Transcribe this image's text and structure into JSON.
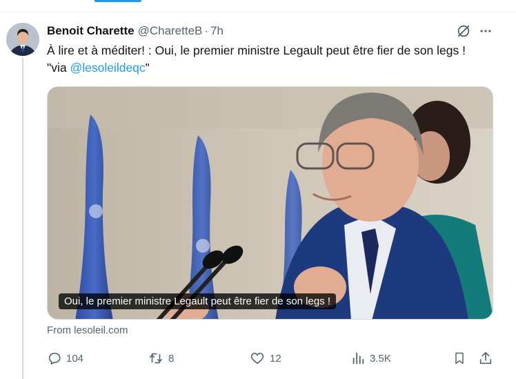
{
  "tweet": {
    "author_name": "Benoit Charette",
    "handle": "@CharetteB",
    "separator": "·",
    "time": "7h",
    "text_main": "À lire et à méditer! : Oui, le premier ministre Legault peut être fier de son legs ! \"via ",
    "mention": "@lesoleildeqc",
    "text_end": "\""
  },
  "card": {
    "caption": "Oui, le premier ministre Legault peut être fier de son legs !",
    "source": "From lesoleil.com"
  },
  "actions": {
    "replies": "104",
    "reposts": "8",
    "likes": "12",
    "views": "3.5K"
  },
  "colors": {
    "accent": "#1d9bf0",
    "text": "#0f1419",
    "muted": "#536471",
    "border": "#cfd9de"
  },
  "icons": [
    "grok-icon",
    "more-icon",
    "reply-icon",
    "repost-icon",
    "like-icon",
    "views-icon",
    "bookmark-icon",
    "share-icon"
  ]
}
